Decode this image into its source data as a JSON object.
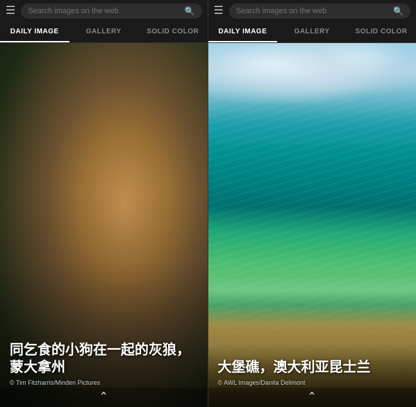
{
  "colors": {
    "headerBg": "#1a1a1a",
    "tabActiveBorder": "#ffffff",
    "tabActiveText": "#ffffff",
    "tabInactiveText": "#888888"
  },
  "left": {
    "header": {
      "searchPlaceholder": "Search images on the web"
    },
    "tabs": [
      {
        "id": "daily-image",
        "label": "DAILY IMAGE",
        "active": true
      },
      {
        "id": "gallery",
        "label": "GALLERY",
        "active": false
      },
      {
        "id": "solid-color",
        "label": "SOLID COLOR",
        "active": false
      }
    ],
    "image": {
      "title": "同乞食的小狗在一起的灰狼，蒙大拿州",
      "credit": "Tim Fitzharris/Minden Pictures",
      "chevronLabel": "⌃"
    }
  },
  "right": {
    "header": {
      "searchPlaceholder": "Search images on the web"
    },
    "tabs": [
      {
        "id": "daily-image",
        "label": "DAILY IMAGE",
        "active": true
      },
      {
        "id": "gallery",
        "label": "GALLERY",
        "active": false
      },
      {
        "id": "solid-color",
        "label": "SOLID COLOR",
        "active": false
      }
    ],
    "image": {
      "title": "大堡礁，澳大利亚昆士兰",
      "credit": "AWL Images/Danita Delimont",
      "chevronLabel": "⌃"
    }
  }
}
